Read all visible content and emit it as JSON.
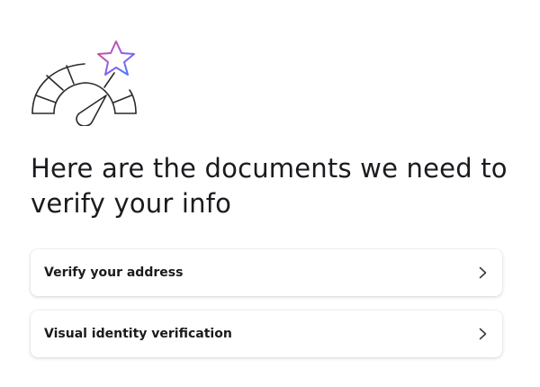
{
  "header": {
    "title": "Here are the documents we need to verify your info"
  },
  "illustration": {
    "icon": "speedometer-star-icon",
    "line_color": "#2b2b2f",
    "star_gradient": [
      "#f14c6b",
      "#8b5cf6",
      "#3b82f6"
    ]
  },
  "documents": [
    {
      "label": "Verify your address",
      "icon": "chevron-right-icon"
    },
    {
      "label": "Visual identity verification",
      "icon": "chevron-right-icon"
    }
  ]
}
